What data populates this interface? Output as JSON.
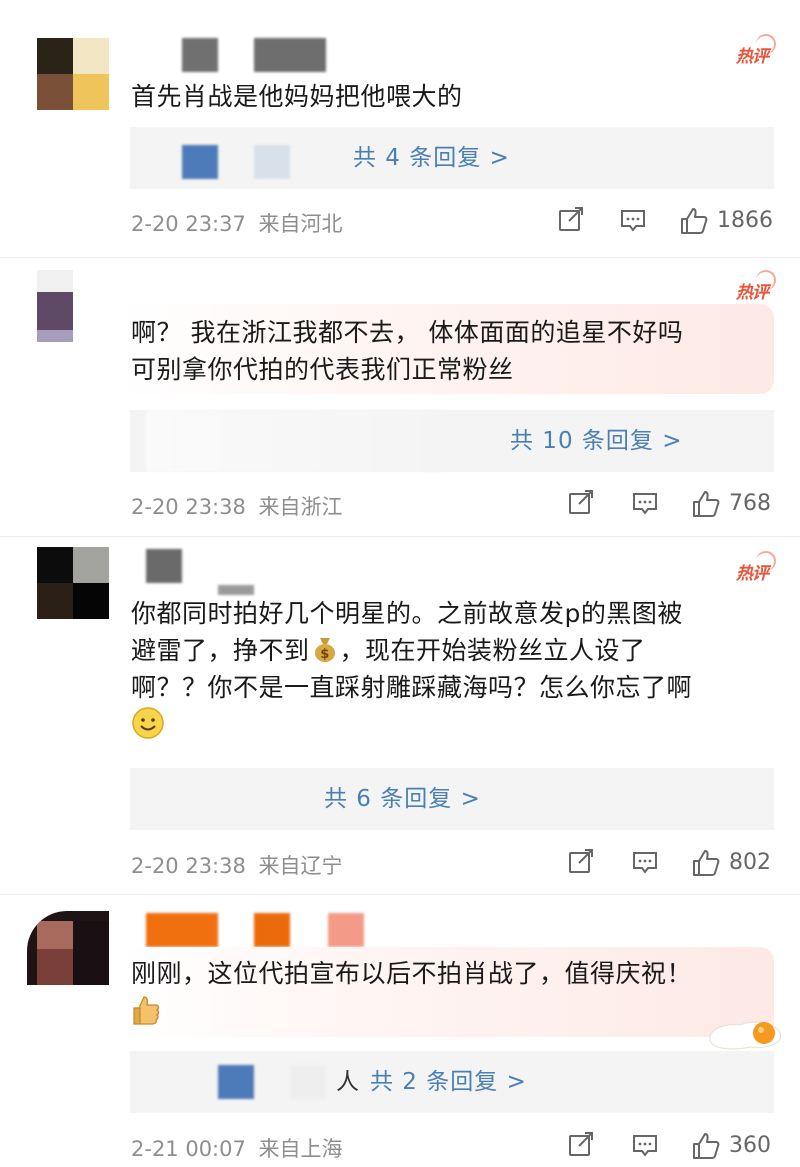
{
  "hot_label": "热评",
  "comments": [
    {
      "text_lines": [
        "首先肖战是他妈妈把他喂大的"
      ],
      "replies_label": "共 4 条回复 >",
      "date": "2-20 23:37",
      "location": "来自河北",
      "likes": "1866"
    },
    {
      "text_lines": [
        "啊？  我在浙江我都不去，  体体面面的追星不好吗",
        "可别拿你代拍的代表我们正常粉丝"
      ],
      "replies_label": "共 10 条回复 >",
      "date": "2-20 23:38",
      "location": "来自浙江",
      "likes": "768"
    },
    {
      "text_lines": [
        "你都同时拍好几个明星的。之前故意发p的黑图被",
        "避雷了，挣不到",
        "，现在开始装粉丝立人设了",
        "啊？？你不是一直踩射雕踩藏海吗？怎么你忘了啊"
      ],
      "emojis": [
        "money-bag",
        "smile"
      ],
      "replies_label": "共 6 条回复 >",
      "date": "2-20 23:38",
      "location": "来自辽宁",
      "likes": "802"
    },
    {
      "text_lines": [
        "刚刚，这位代拍宣布以后不拍肖战了，值得庆祝！"
      ],
      "emojis": [
        "thumbs-up"
      ],
      "reply_prefix": "人",
      "replies_label": "共 2 条回复 >",
      "date": "2-21 00:07",
      "location": "来自上海",
      "likes": "360"
    }
  ],
  "icons": [
    "share-icon",
    "comment-icon",
    "like-icon"
  ],
  "colors": {
    "link": "#4a7fb5",
    "hot": "#e8553a",
    "meta": "#8e8e8e"
  }
}
